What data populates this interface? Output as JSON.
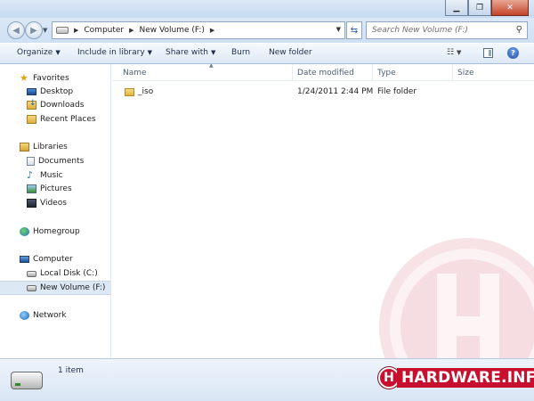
{
  "address": {
    "crumbs": [
      "Computer",
      "New Volume (F:)"
    ]
  },
  "search": {
    "placeholder": "Search New Volume (F:)"
  },
  "toolbar": {
    "organize": "Organize",
    "include_in_library": "Include in library",
    "share_with": "Share with",
    "burn": "Burn",
    "new_folder": "New folder"
  },
  "nav": {
    "favorites": "Favorites",
    "desktop": "Desktop",
    "downloads": "Downloads",
    "recent_places": "Recent Places",
    "libraries": "Libraries",
    "documents": "Documents",
    "music": "Music",
    "pictures": "Pictures",
    "videos": "Videos",
    "homegroup": "Homegroup",
    "computer": "Computer",
    "local_disk": "Local Disk (C:)",
    "new_volume": "New Volume (F:)",
    "network": "Network"
  },
  "columns": {
    "name": "Name",
    "date_modified": "Date modified",
    "type": "Type",
    "size": "Size"
  },
  "files": [
    {
      "name": "_iso",
      "date_modified": "1/24/2011 2:44 PM",
      "type": "File folder",
      "size": ""
    }
  ],
  "status": {
    "item_count": "1 item"
  },
  "watermark": {
    "brand": "HARDWARE.INFO",
    "letter": "H"
  },
  "colors": {
    "accent": "#c8102e"
  }
}
